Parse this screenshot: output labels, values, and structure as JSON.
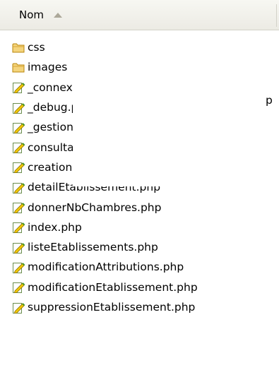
{
  "header": {
    "column_label": "Nom"
  },
  "files": [
    {
      "name": "css",
      "icon": "folder-icon"
    },
    {
      "name": "images",
      "icon": "folder-icon"
    },
    {
      "name": "_connexion.php",
      "icon": "php-file-icon"
    },
    {
      "name": "_debug.php",
      "icon": "php-file-icon"
    },
    {
      "name": "_gestion.php",
      "icon": "php-file-icon"
    },
    {
      "name": "consultation.php",
      "icon": "php-file-icon"
    },
    {
      "name": "creationEtablissement.php",
      "icon": "php-file-icon"
    },
    {
      "name": "detailEtablissement.php",
      "icon": "php-file-icon"
    },
    {
      "name": "donnerNbChambres.php",
      "icon": "php-file-icon"
    },
    {
      "name": "index.php",
      "icon": "php-file-icon"
    },
    {
      "name": "listeEtablissements.php",
      "icon": "php-file-icon"
    },
    {
      "name": "modificationAttributions.php",
      "icon": "php-file-icon"
    },
    {
      "name": "modificationEtablissement.php",
      "icon": "php-file-icon"
    },
    {
      "name": "suppressionEtablissement.php",
      "icon": "php-file-icon"
    }
  ],
  "overlay_fragment": "p",
  "colors": {
    "header_bg": "#ecebe4",
    "sort_arrow": "#aca899",
    "folder_fill": "#f4d47c",
    "folder_stroke": "#b8860b",
    "pencil_yellow": "#f0c808",
    "pencil_green": "#3c9a2a"
  }
}
